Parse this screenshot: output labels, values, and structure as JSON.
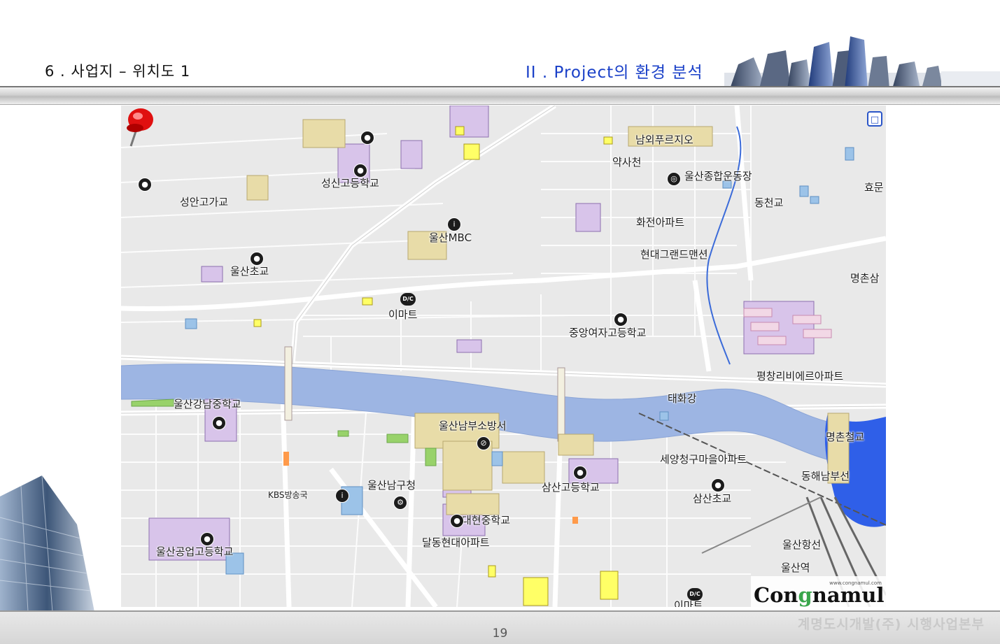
{
  "header": {
    "slide_title": "6 . 사업지 – 위치도 1",
    "section_title": "II .  Project의 환경 분석"
  },
  "map": {
    "toggle_icon": "map-mode-icon",
    "labels": [
      {
        "id": "namoe",
        "text": "남외푸르지오"
      },
      {
        "id": "yaksa",
        "text": "약사천"
      },
      {
        "id": "stadium",
        "text": "울산종합운동장"
      },
      {
        "id": "dongcheon",
        "text": "동천교"
      },
      {
        "id": "hyo",
        "text": "효문"
      },
      {
        "id": "seongsin",
        "text": "성신고등학교"
      },
      {
        "id": "seongan",
        "text": "성안고가교"
      },
      {
        "id": "mbc",
        "text": "울산MBC"
      },
      {
        "id": "hwajeon",
        "text": "화전아파트"
      },
      {
        "id": "hyundai-grand",
        "text": "현대그랜드맨션"
      },
      {
        "id": "myeongchon-s",
        "text": "명촌삼"
      },
      {
        "id": "ulsan-elem",
        "text": "울산초교"
      },
      {
        "id": "emart",
        "text": "이마트"
      },
      {
        "id": "jungang",
        "text": "중앙여자고등학교"
      },
      {
        "id": "pyeongchang",
        "text": "평창리비에르아파트"
      },
      {
        "id": "gangnam",
        "text": "울산강남중학교"
      },
      {
        "id": "taehwa",
        "text": "태화강"
      },
      {
        "id": "fire",
        "text": "울산남부소방서"
      },
      {
        "id": "myeongchon-bridge",
        "text": "명촌철교"
      },
      {
        "id": "seyang",
        "text": "세양청구마을아파트"
      },
      {
        "id": "donghae",
        "text": "동해남부선"
      },
      {
        "id": "kbs",
        "text": "KBS방송국"
      },
      {
        "id": "namgu",
        "text": "울산남구청"
      },
      {
        "id": "samsan-high",
        "text": "삼산고등학교"
      },
      {
        "id": "samsan-elem",
        "text": "삼산초교"
      },
      {
        "id": "daehyeon",
        "text": "대현중학교"
      },
      {
        "id": "dalgdong",
        "text": "달동현대아파트"
      },
      {
        "id": "ulsan-line",
        "text": "울산항선"
      },
      {
        "id": "ulsan-station",
        "text": "울산역"
      },
      {
        "id": "industrial",
        "text": "울산공업고등학교"
      },
      {
        "id": "emart2",
        "text": "이마트"
      }
    ],
    "brand": {
      "url": "www.congnamul.com",
      "name_left": "Con",
      "name_dot": "g",
      "name_right": "namul"
    }
  },
  "footer": {
    "page_number": "19",
    "company": "계명도시개발(주)  시행사업본부"
  }
}
